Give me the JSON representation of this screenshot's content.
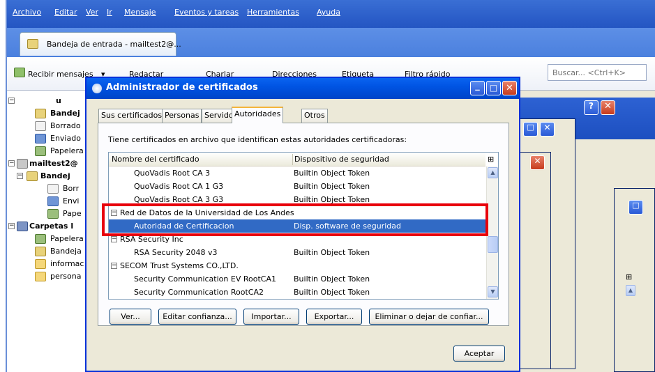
{
  "menubar": {
    "items": [
      "Archivo",
      "Editar",
      "Ver",
      "Ir",
      "Mensaje",
      "Eventos y tareas",
      "Herramientas",
      "Ayuda"
    ]
  },
  "mail_tab": {
    "label": "Bandeja de entrada - mailtest2@..."
  },
  "toolbar": {
    "get_mail_label": "Recibir mensajes",
    "write_label": "Redactar",
    "chat_label": "Charlar",
    "address_label": "Direcciones",
    "tag_label": "Etiqueta",
    "filter_label": "Filtro rápido"
  },
  "search": {
    "placeholder": "Buscar... <Ctrl+K>"
  },
  "folder_pane": {
    "rows": [
      {
        "label": "u",
        "level": 0
      },
      {
        "label": "Bandej",
        "level": 1,
        "bold": true
      },
      {
        "label": "Borrado",
        "level": 1
      },
      {
        "label": "Enviado",
        "level": 1
      },
      {
        "label": "Papelera",
        "level": 1
      },
      {
        "label": "mailtest2@",
        "level": 0,
        "bold": true
      },
      {
        "label": "Bandej",
        "level": 1,
        "bold": true
      },
      {
        "label": "Borr",
        "level": 2
      },
      {
        "label": "Envi",
        "level": 2
      },
      {
        "label": "Pape",
        "level": 2
      },
      {
        "label": "Carpetas l",
        "level": 0,
        "bold": true
      },
      {
        "label": "Papelera",
        "level": 1
      },
      {
        "label": "Bandeja",
        "level": 1
      },
      {
        "label": "informac",
        "level": 1
      },
      {
        "label": "persona",
        "level": 1
      }
    ]
  },
  "dialog": {
    "title": "Administrador de certificados",
    "tabs": [
      "Sus certificados",
      "Personas",
      "Servidores",
      "Autoridades",
      "Otros"
    ],
    "active_tab": "Autoridades",
    "description": "Tiene certificados en archivo que identifican estas autoridades certificadoras:",
    "columns": [
      "Nombre del certificado",
      "Dispositivo de seguridad"
    ],
    "rows": [
      {
        "type": "item",
        "name": "QuoVadis Root CA 3",
        "device": "Builtin Object Token"
      },
      {
        "type": "item",
        "name": "QuoVadis Root CA 1 G3",
        "device": "Builtin Object Token"
      },
      {
        "type": "item",
        "name": "QuoVadis Root CA 3 G3",
        "device": "Builtin Object Token"
      },
      {
        "type": "group",
        "name": "Red de Datos de la Universidad de Los Andes",
        "device": ""
      },
      {
        "type": "item",
        "name": "Autoridad de Certificacion",
        "device": "Disp. software de seguridad",
        "selected": true
      },
      {
        "type": "group",
        "name": "RSA Security Inc",
        "device": ""
      },
      {
        "type": "item",
        "name": "RSA Security 2048 v3",
        "device": "Builtin Object Token"
      },
      {
        "type": "group",
        "name": "SECOM Trust Systems CO.,LTD.",
        "device": ""
      },
      {
        "type": "item",
        "name": "Security Communication EV RootCA1",
        "device": "Builtin Object Token"
      },
      {
        "type": "item",
        "name": "Security Communication RootCA2",
        "device": "Builtin Object Token"
      }
    ],
    "buttons": {
      "view": "Ver...",
      "edit_trust": "Editar confianza...",
      "import": "Importar...",
      "export": "Exportar...",
      "delete": "Eliminar o dejar de confiar..."
    },
    "ok": "Aceptar"
  },
  "colors": {
    "highlight_border": "#e8000b",
    "selection": "#316ac5",
    "titlebar": "#0054e3"
  }
}
